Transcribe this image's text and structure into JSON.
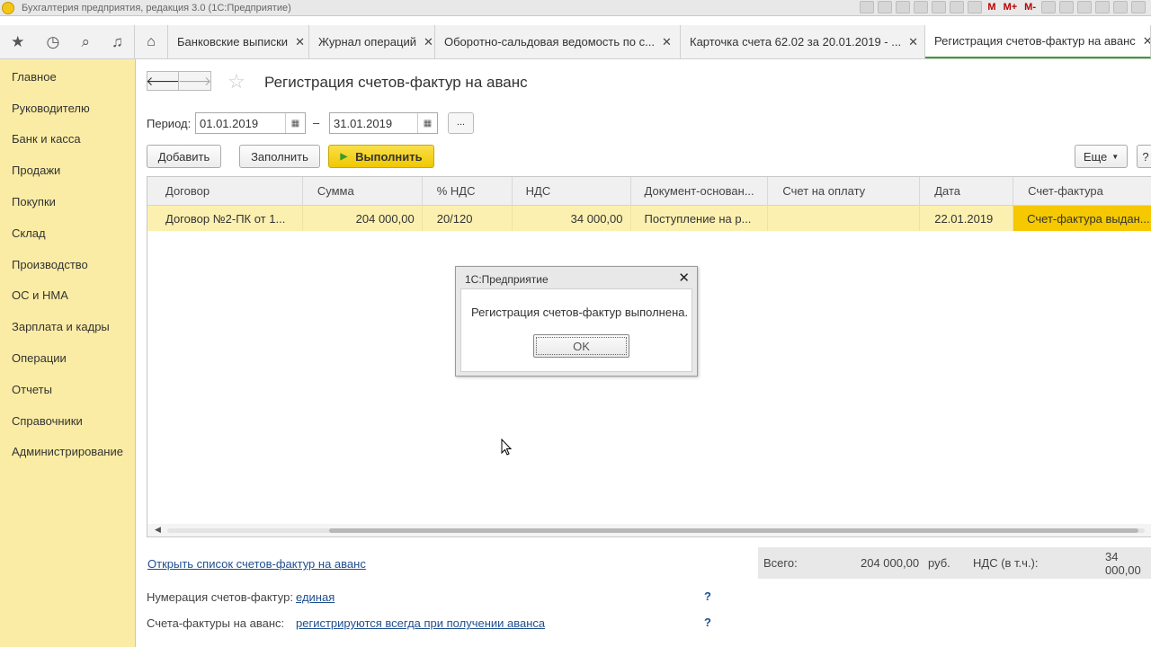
{
  "window": {
    "title": "Бухгалтерия предприятия, редакция 3.0  (1С:Предприятие)",
    "toolbar_m": [
      "M",
      "M+",
      "M-"
    ]
  },
  "nav_icons": [
    "star-icon",
    "history-icon",
    "search-icon",
    "bell-icon"
  ],
  "tabs": [
    {
      "label": "Банковские выписки"
    },
    {
      "label": "Журнал операций"
    },
    {
      "label": "Оборотно-сальдовая ведомость по с..."
    },
    {
      "label": "Карточка счета 62.02 за 20.01.2019 - ..."
    },
    {
      "label": "Регистрация счетов-фактур на аванс"
    }
  ],
  "sidebar": {
    "items": [
      {
        "label": "Главное"
      },
      {
        "label": "Руководителю"
      },
      {
        "label": "Банк и касса"
      },
      {
        "label": "Продажи"
      },
      {
        "label": "Покупки"
      },
      {
        "label": "Склад"
      },
      {
        "label": "Производство"
      },
      {
        "label": "ОС и НМА"
      },
      {
        "label": "Зарплата и кадры"
      },
      {
        "label": "Операции"
      },
      {
        "label": "Отчеты"
      },
      {
        "label": "Справочники"
      },
      {
        "label": "Администрирование"
      }
    ]
  },
  "form": {
    "title": "Регистрация счетов-фактур на аванс",
    "period_label": "Период:",
    "date_from": "01.01.2019",
    "date_to": "31.01.2019",
    "dash": "–",
    "dots_label": "...",
    "buttons": {
      "add": "Добавить",
      "fill": "Заполнить",
      "run": "Выполнить",
      "more": "Еще"
    },
    "table": {
      "columns": [
        "Договор",
        "Сумма",
        "% НДС",
        "НДС",
        "Документ-основан...",
        "Счет на оплату",
        "Дата",
        "Счет-фактура"
      ],
      "rows": [
        [
          "Договор №2-ПК от 1...",
          "204 000,00",
          "20/120",
          "34 000,00",
          "Поступление на р...",
          "",
          "22.01.2019",
          "Счет-фактура выдан..."
        ]
      ]
    },
    "open_list_link": "Открыть список счетов-фактур на аванс",
    "totals": {
      "label": "Всего:",
      "sum": "204 000,00",
      "currency": "руб.",
      "vat_label": "НДС (в т.ч.):",
      "vat": "34 000,00"
    },
    "numbering_label": "Нумерация счетов-фактур:",
    "numbering_value": "единая",
    "advance_label": "Счета-фактуры на аванс:",
    "advance_value": "регистрируются всегда при получении аванса",
    "help": "?"
  },
  "dialog": {
    "title": "1С:Предприятие",
    "message": "Регистрация счетов-фактур выполнена.",
    "ok": "OK"
  }
}
